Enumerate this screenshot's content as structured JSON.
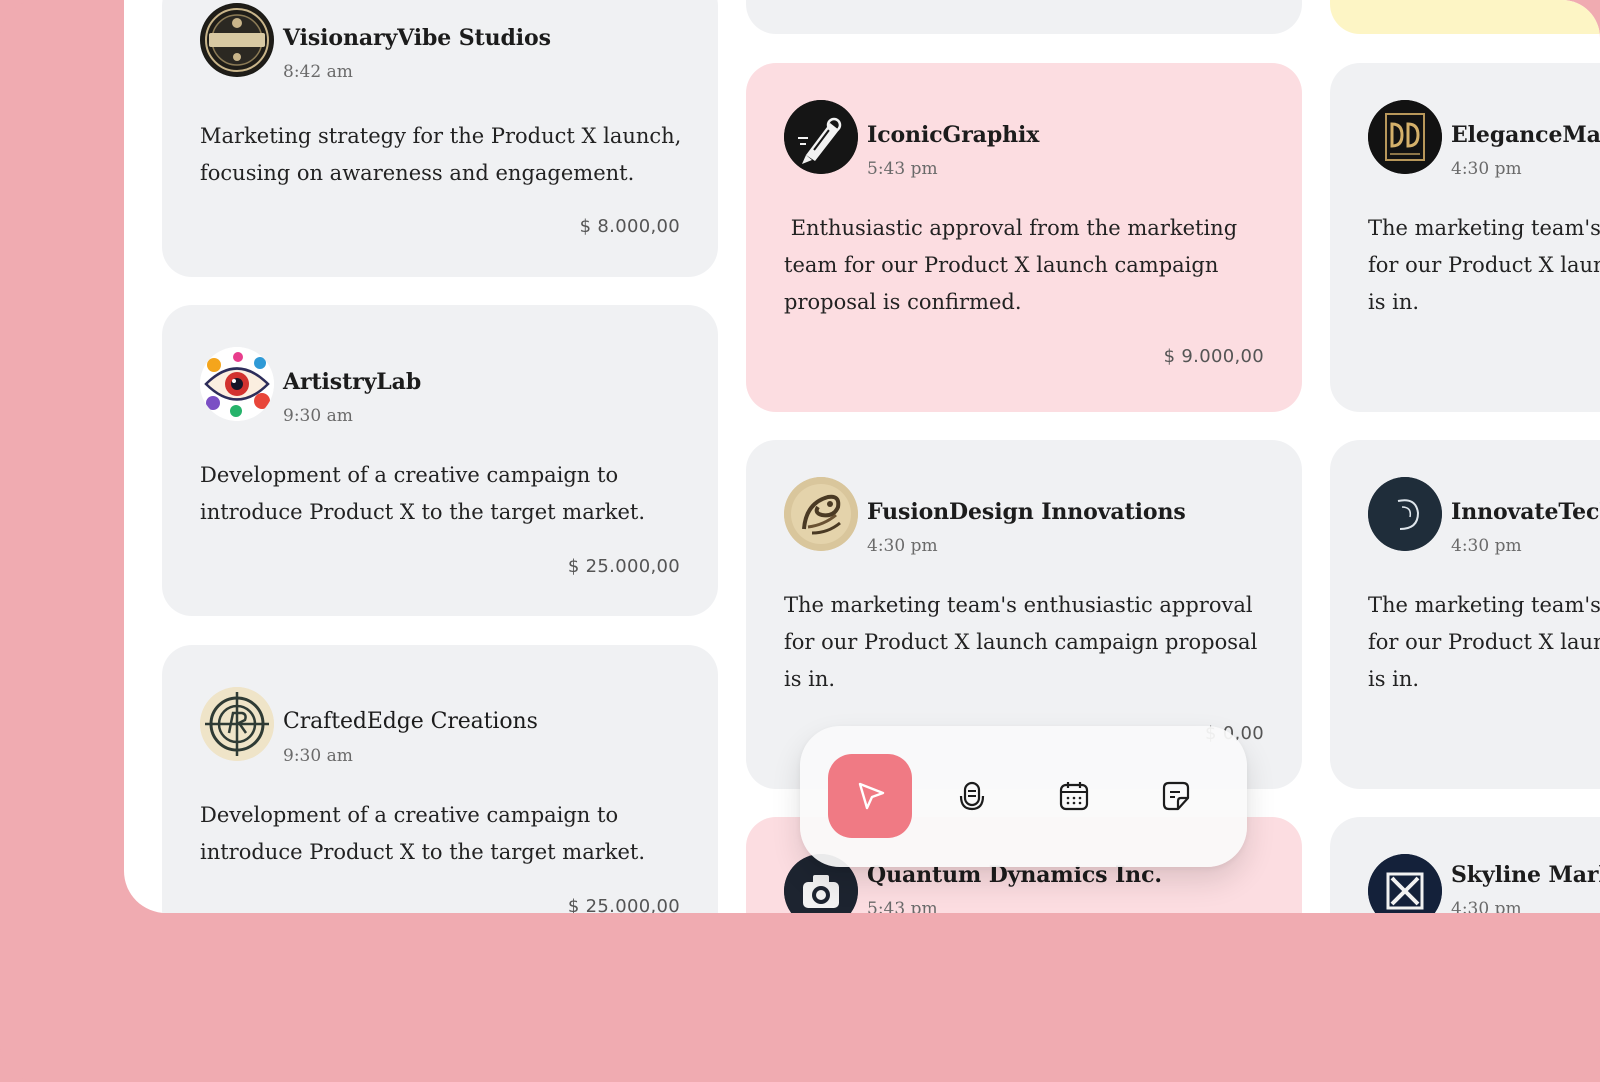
{
  "cards": [
    {
      "name": "VisionaryVibe Studios",
      "time": "8:42 am",
      "description": "Marketing strategy for the Product X launch, focusing on awareness and engagement.",
      "amount": "$ 8.000,00",
      "avatar_icon": "desaigy-badge-logo"
    },
    {
      "name": "ArtistryLab",
      "time": "9:30 am",
      "description": "Development of a creative campaign to introduce Product X to the target market.",
      "amount": "$ 25.000,00",
      "avatar_icon": "colorful-eye-logo"
    },
    {
      "name": "CraftedEdge Creations",
      "time": "9:30 am",
      "description": "Development of a creative campaign to introduce Product X to the target market.",
      "amount": "$ 25.000,00",
      "avatar_icon": "target-emblem-logo"
    },
    {
      "name": "IconicGraphix",
      "time": "5:43 pm",
      "description": " Enthusiastic approval from the marketing team for our Product X launch campaign proposal is confirmed.",
      "amount": "$ 9.000,00",
      "avatar_icon": "pen-nib-logo"
    },
    {
      "name": "FusionDesign Innovations",
      "time": "4:30 pm",
      "description": "The marketing team's enthusiastic approval for our Product X launch campaign proposal is in.",
      "amount": "$ 0,00",
      "avatar_icon": "ornamental-swirl-logo"
    },
    {
      "name": "Quantum Dynamics Inc.",
      "time": "5:43 pm",
      "avatar_icon": "camera-logo"
    },
    {
      "name": "EleganceMak",
      "time": "4:30 pm",
      "description": "The marketing team's\nfor our Product X laun\nis in.",
      "avatar_icon": "dd-monogram-logo"
    },
    {
      "name": "InnovateTech",
      "time": "4:30 pm",
      "description": "The marketing team's\nfor our Product X laun\nis in.",
      "avatar_icon": "crescent-swirl-logo"
    },
    {
      "name": "Skyline Mark",
      "time": "4:30 pm",
      "avatar_icon": "x-monogram-logo"
    }
  ],
  "toolbar": {
    "items": [
      {
        "icon": "send-cursor-icon",
        "active": true
      },
      {
        "icon": "microphone-icon",
        "active": false
      },
      {
        "icon": "calendar-icon",
        "active": false
      },
      {
        "icon": "note-icon",
        "active": false
      }
    ]
  },
  "colors": {
    "background": "#f0abb1",
    "card_gray": "#f0f1f3",
    "card_pink": "#fcdde1",
    "card_yellow": "#fdf5c5",
    "accent": "#f07a84"
  }
}
